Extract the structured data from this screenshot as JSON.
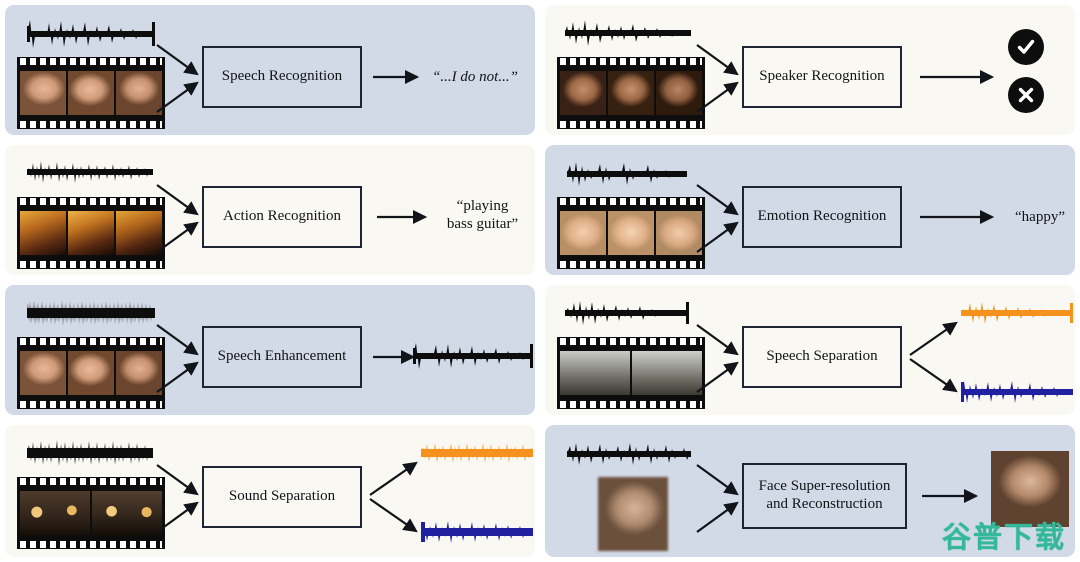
{
  "figure": {
    "background_color": "#ffffff",
    "panel_blue": "#d2dae8",
    "panel_cream": "#faf8f2",
    "ink": "#111418",
    "box_border": "#1d2433",
    "wave_black": "#0d0d0d",
    "wave_orange": "#f5921e",
    "wave_blue": "#2020a0"
  },
  "watermark": {
    "text": "谷普下载",
    "color": "#35b89a"
  },
  "panels": [
    {
      "id": "speech-recognition",
      "theme": "blue",
      "task_label": "Speech Recognition",
      "inputs": {
        "audio": "waveform",
        "visual": "film-strip-face-woman"
      },
      "output": {
        "type": "text",
        "text": "“...I do not...”",
        "style": "italic"
      }
    },
    {
      "id": "speaker-recognition",
      "theme": "cream",
      "task_label": "Speaker Recognition",
      "inputs": {
        "audio": "waveform",
        "visual": "film-strip-face-man"
      },
      "output": {
        "type": "badges",
        "badges": [
          "check-badge",
          "cross-badge"
        ]
      }
    },
    {
      "id": "action-recognition",
      "theme": "cream",
      "task_label": "Action Recognition",
      "inputs": {
        "audio": "waveform",
        "visual": "film-strip-guitar"
      },
      "output": {
        "type": "text",
        "text": "“playing\nbass guitar”",
        "style": "normal"
      }
    },
    {
      "id": "emotion-recognition",
      "theme": "blue",
      "task_label": "Emotion Recognition",
      "inputs": {
        "audio": "waveform",
        "visual": "film-strip-face-blonde"
      },
      "output": {
        "type": "text",
        "text": "“happy”",
        "style": "normal"
      }
    },
    {
      "id": "speech-enhancement",
      "theme": "blue",
      "task_label": "Speech Enhancement",
      "inputs": {
        "audio": "waveform-noisy",
        "visual": "film-strip-face-woman"
      },
      "output": {
        "type": "waveform",
        "color": "#0d0d0d"
      }
    },
    {
      "id": "speech-separation",
      "theme": "cream",
      "task_label": "Speech Separation",
      "inputs": {
        "audio": "waveform",
        "visual": "film-strip-two-speakers"
      },
      "output": {
        "type": "waveform-pair",
        "colors": [
          "#f5921e",
          "#2020a0"
        ]
      }
    },
    {
      "id": "sound-separation",
      "theme": "cream",
      "task_label": "Sound Separation",
      "inputs": {
        "audio": "waveform-noisy",
        "visual": "film-strip-band"
      },
      "output": {
        "type": "waveform-pair",
        "colors": [
          "#f5921e",
          "#2020a0"
        ]
      }
    },
    {
      "id": "face-super-resolution",
      "theme": "blue",
      "task_label": "Face Super-resolution\nand Reconstruction",
      "inputs": {
        "audio": "waveform",
        "visual": "low-res-face-photo"
      },
      "output": {
        "type": "image",
        "label": "high-res-face-photo"
      }
    }
  ]
}
